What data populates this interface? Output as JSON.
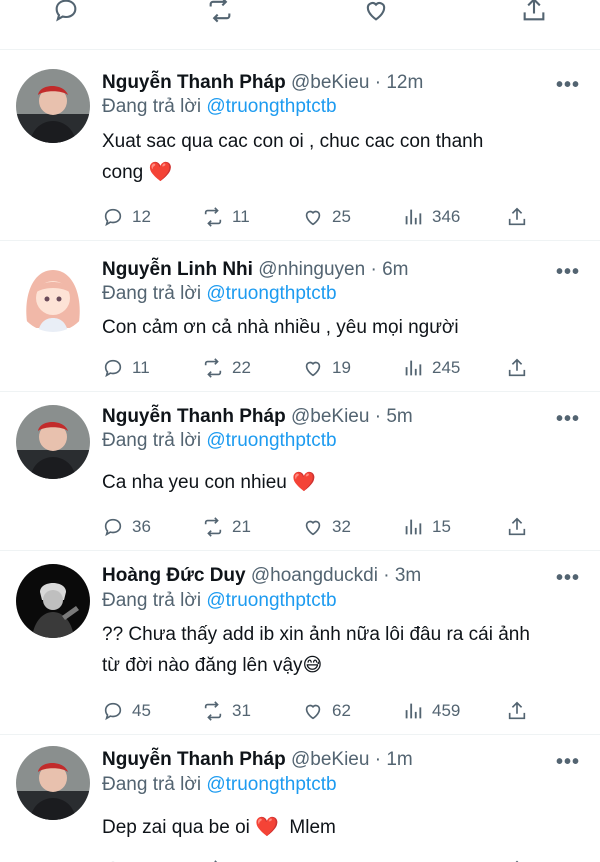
{
  "top_actions": {
    "icons": [
      "reply-icon",
      "retweet-icon",
      "like-icon",
      "share-icon"
    ]
  },
  "reply_prefix": "Đang trả lời",
  "tweets": [
    {
      "name": "Nguyễn Thanh Pháp",
      "handle": "@beKieu",
      "time": "12m",
      "reply_to": "@truongthptctb",
      "text_lines": [
        "Xuat sac qua cac con oi , chuc cac con thanh",
        "cong"
      ],
      "emoji": "❤️",
      "replies": "12",
      "retweets": "11",
      "likes": "25",
      "views": "346"
    },
    {
      "name": "Nguyễn Linh Nhi",
      "handle": "@nhinguyen",
      "time": "6m",
      "reply_to": "@truongthptctb",
      "text_lines": [
        "Con cảm ơn cả nhà nhiều , yêu mọi người"
      ],
      "replies": "11",
      "retweets": "22",
      "likes": "19",
      "views": "245"
    },
    {
      "name": "Nguyễn Thanh Pháp",
      "handle": "@beKieu",
      "time": "5m",
      "reply_to": "@truongthptctb",
      "text_lines": [
        "Ca nha yeu con nhieu"
      ],
      "emoji": "❤️",
      "replies": "36",
      "retweets": "21",
      "likes": "32",
      "views": "15"
    },
    {
      "name": "Hoàng Đức Duy",
      "handle": "@hoangduckdi",
      "time": "3m",
      "reply_to": "@truongthptctb",
      "text_lines": [
        "?? Chưa thấy add ib xin ảnh nữa lôi đâu ra cái ảnh",
        "từ đời nào đăng lên vậy"
      ],
      "emoji": "😅",
      "replies": "45",
      "retweets": "31",
      "likes": "62",
      "views": "459"
    },
    {
      "name": "Nguyễn Thanh Pháp",
      "handle": "@beKieu",
      "time": "1m",
      "reply_to": "@truongthptctb",
      "text_lines": [
        "Dep zai qua be oi"
      ],
      "emoji": "❤️",
      "text_suffix": "Mlem"
    }
  ]
}
